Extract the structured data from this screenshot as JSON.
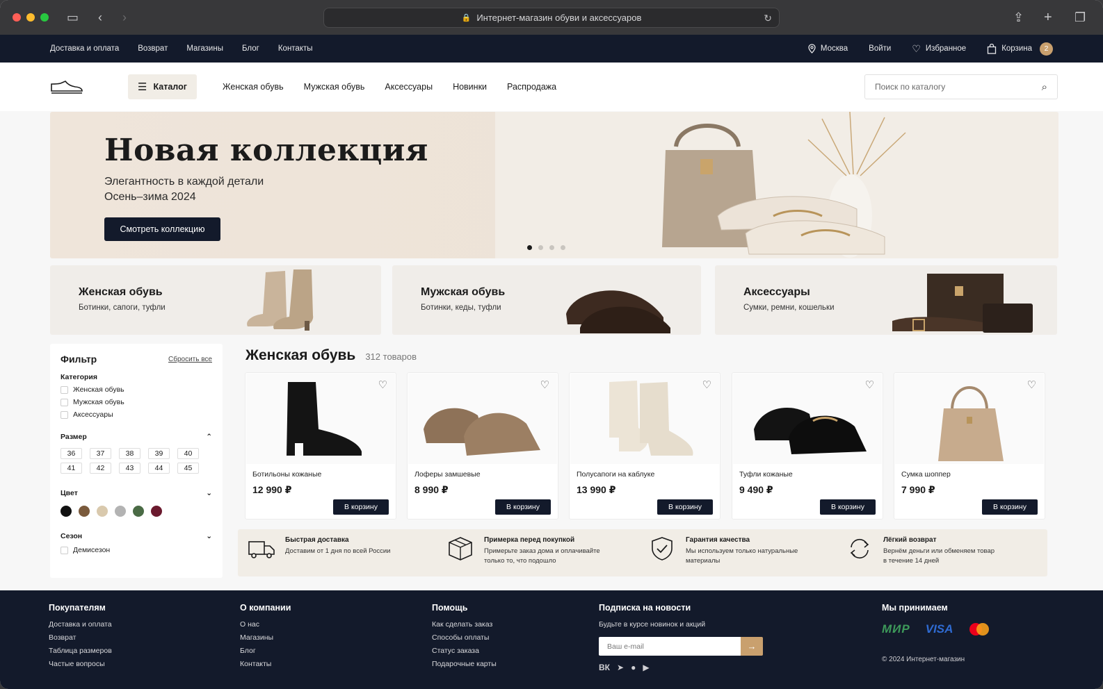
{
  "browser": {
    "url_title": "Интернет-магазин обуви и аксессуаров"
  },
  "topbar": {
    "links": [
      "Доставка и оплата",
      "Возврат",
      "Магазины",
      "Блог",
      "Контакты"
    ],
    "city": "Москва",
    "login": "Войти",
    "favorites": "Избранное",
    "cart": "Корзина",
    "cart_count": "2"
  },
  "header": {
    "catalog": "Каталог",
    "nav": [
      "Женская обувь",
      "Мужская обувь",
      "Аксессуары",
      "Новинки",
      "Распродажа"
    ],
    "search_placeholder": "Поиск по каталогу"
  },
  "hero": {
    "title": "Новая коллекция",
    "subtitle1": "Элегантность в каждой детали",
    "subtitle2": "Осень–зима 2024",
    "button": "Смотреть коллекцию",
    "slides": 4,
    "active_slide": 1
  },
  "categories": [
    {
      "title": "Женская обувь",
      "sub": "Ботинки, сапоги, туфли"
    },
    {
      "title": "Мужская обувь",
      "sub": "Ботинки, кеды, туфли"
    },
    {
      "title": "Аксессуары",
      "sub": "Сумки, ремни, кошельки"
    }
  ],
  "filter": {
    "title": "Фильтр",
    "reset": "Сбросить все",
    "category_label": "Категория",
    "categories": [
      "Женская обувь",
      "Мужская обувь",
      "Аксессуары"
    ],
    "size_label": "Размер",
    "sizes": [
      "36",
      "37",
      "38",
      "39",
      "40",
      "41",
      "42",
      "43",
      "44",
      "45"
    ],
    "color_label": "Цвет",
    "colors": [
      "#111111",
      "#7a5a3c",
      "#d9c9ad",
      "#b3b3b3",
      "#4a6b45",
      "#6b1a2e"
    ],
    "season_label": "Сезон",
    "seasons": [
      "Демисезон"
    ]
  },
  "products_section": {
    "title": "Женская обувь",
    "count": "312 товаров"
  },
  "products": [
    {
      "name": "Ботильоны кожаные",
      "price": "12 990 ₽",
      "button": "В корзину"
    },
    {
      "name": "Лоферы замшевые",
      "price": "8 990 ₽",
      "button": "В корзину"
    },
    {
      "name": "Полусапоги на каблуке",
      "price": "13 990 ₽",
      "button": "В корзину"
    },
    {
      "name": "Туфли кожаные",
      "price": "9 490 ₽",
      "button": "В корзину"
    },
    {
      "name": "Сумка шоппер",
      "price": "7 990 ₽",
      "button": "В корзину"
    }
  ],
  "benefits": [
    {
      "title": "Быстрая доставка",
      "desc": "Доставим от 1 дня по всей России"
    },
    {
      "title": "Примерка перед покупкой",
      "desc": "Примерьте заказ дома и оплачивайте\nтолько то, что подошло"
    },
    {
      "title": "Гарантия качества",
      "desc": "Мы используем только натуральные\nматериалы"
    },
    {
      "title": "Лёгкий возврат",
      "desc": "Вернём деньги или обменяем товар\nв течение 14 дней"
    }
  ],
  "footer": {
    "buyers": {
      "title": "Покупателям",
      "links": [
        "Доставка и оплата",
        "Возврат",
        "Таблица размеров",
        "Частые вопросы"
      ]
    },
    "company": {
      "title": "О компании",
      "links": [
        "О нас",
        "Магазины",
        "Блог",
        "Контакты"
      ]
    },
    "help": {
      "title": "Помощь",
      "links": [
        "Как сделать заказ",
        "Способы оплаты",
        "Статус заказа",
        "Подарочные карты"
      ]
    },
    "subscribe": {
      "title": "Подписка на новости",
      "desc": "Будьте в курсе новинок и акций",
      "placeholder": "Ваш e-mail"
    },
    "payments": {
      "title": "Мы принимаем",
      "mir": "МИР",
      "visa": "VISA"
    },
    "copyright": "© 2024 Интернет-магазин"
  }
}
